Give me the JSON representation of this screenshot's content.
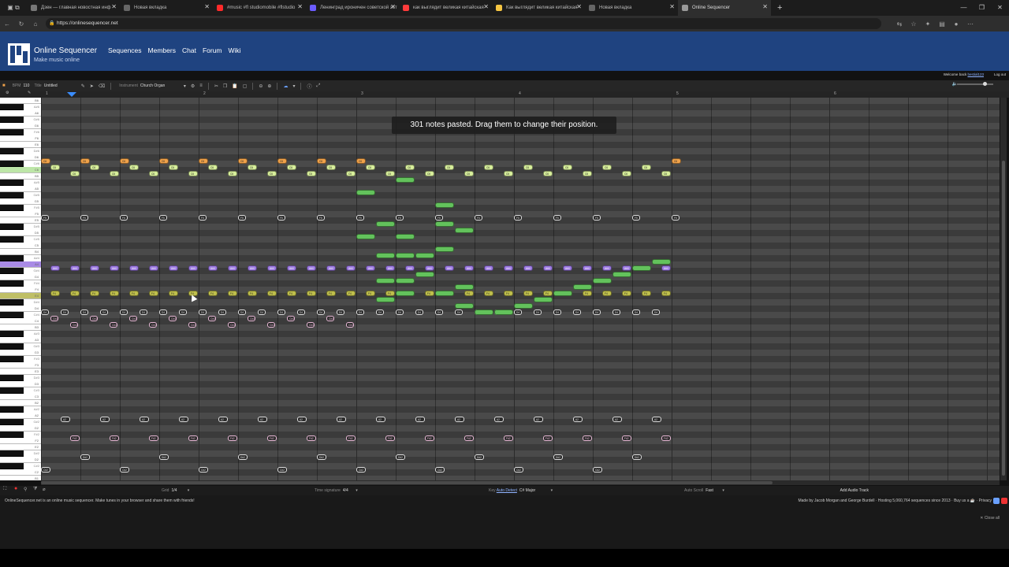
{
  "browser": {
    "tabs": [
      {
        "label": "Дзен — главная новостная инф",
        "color": "#777777"
      },
      {
        "label": "Новая вкладка",
        "color": "#666666"
      },
      {
        "label": "#music #fl studiomobile #flstudio",
        "color": "#ff2a2a"
      },
      {
        "label": "Ленинград ироничен советской эст",
        "color": "#6b5cff"
      },
      {
        "label": "как выглядит великая китайская",
        "color": "#ff3b3b"
      },
      {
        "label": "Как выглядит великая китайская",
        "color": "#f5c542"
      },
      {
        "label": "Новая вкладка",
        "color": "#666666"
      },
      {
        "label": "Online Sequencer",
        "color": "#9a9a9a"
      }
    ],
    "url": "https://onlinesequencer.net",
    "window_controls": [
      "—",
      "❐",
      "✕"
    ]
  },
  "site": {
    "brand": "Online Sequencer",
    "tagline": "Make music online",
    "nav": [
      "Sequences",
      "Members",
      "Chat",
      "Forum",
      "Wiki"
    ],
    "welcome_text": "Welcome back",
    "username": "bestial123",
    "logout": "Log out"
  },
  "toolbar": {
    "bpm_label": "BPM",
    "bpm": "110",
    "title_label": "Title",
    "title": "Untitled",
    "instrument_label": "Instrument",
    "instrument": "Church Organ"
  },
  "ruler": [
    "1",
    "2",
    "3",
    "4",
    "5",
    "6"
  ],
  "toast": "301 notes pasted. Drag them to change their position.",
  "bottom": {
    "grid_label": "Grid",
    "grid": "1/4",
    "timesig_label": "Time signature",
    "timesig": "4/4",
    "key_label": "Key",
    "auto_detect": "Auto Detect",
    "key": "C# Major",
    "autoscroll_label": "Auto Scroll",
    "autoscroll": "Fast",
    "add_audio": "Add Audio Track"
  },
  "footer": {
    "about": "OnlineSequencer.net is an online music sequencer. Make tunes in your browser and share them with friends!",
    "credits": "Made by Jacob Morgan and George Burdell · Hosting 5,060,764 sequences since 2013 · Buy us a ☕ · Privacy",
    "close_all": "✕ Close all"
  },
  "colors": {
    "header_blue": "#1f4380",
    "grid": "#414141",
    "note_orange": "#f0a24a",
    "note_lightgreen": "#d8ef9c",
    "note_green": "#63c25c",
    "note_purple": "#9b79e0",
    "note_olive": "#bfbf4c"
  },
  "notes": {
    "orange": "C6",
    "lightgreen": "C6",
    "white_f5": "F5",
    "purple": "A#4",
    "olive": "F4",
    "upper_d": "D4",
    "lower_c": "C#4",
    "a2": "A2",
    "fs2": "F#2",
    "ds2": "D#2",
    "cs2": "C#2"
  }
}
